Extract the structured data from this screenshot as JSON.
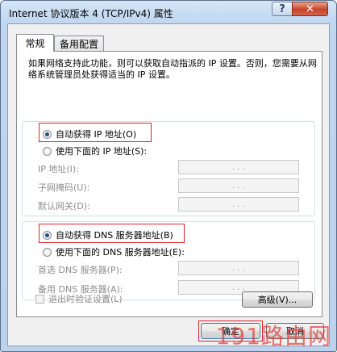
{
  "window": {
    "title": "Internet 协议版本 4 (TCP/IPv4) 属性",
    "help_label": "?",
    "close_label": "✕"
  },
  "tabs": [
    {
      "label": "常规"
    },
    {
      "label": "备用配置"
    }
  ],
  "description": "如果网络支持此功能，则可以获取自动指派的 IP 设置。否则，您需要从网络系统管理员处获得适当的 IP 设置。",
  "ip": {
    "auto_label": "自动获得 IP 地址(O)",
    "manual_label": "使用下面的 IP 地址(S):",
    "selected": "auto",
    "fields": [
      {
        "label": "IP 地址(I):",
        "value": ". . ."
      },
      {
        "label": "子网掩码(U):",
        "value": ". . ."
      },
      {
        "label": "默认网关(D):",
        "value": ". . ."
      }
    ]
  },
  "dns": {
    "auto_label": "自动获得 DNS 服务器地址(B)",
    "manual_label": "使用下面的 DNS 服务器地址(E):",
    "selected": "auto",
    "fields": [
      {
        "label": "首选 DNS 服务器(P):",
        "value": ". . ."
      },
      {
        "label": "备用 DNS 服务器(A):",
        "value": ". . ."
      }
    ]
  },
  "validate_label": "退出时验证设置(L)",
  "advanced_label": "高级(V)...",
  "ok_label": "确定",
  "cancel_label": "取消",
  "watermark": "191路由网",
  "colors": {
    "highlight_border": "#d9262b",
    "radio_dot": "#1c4f91"
  }
}
